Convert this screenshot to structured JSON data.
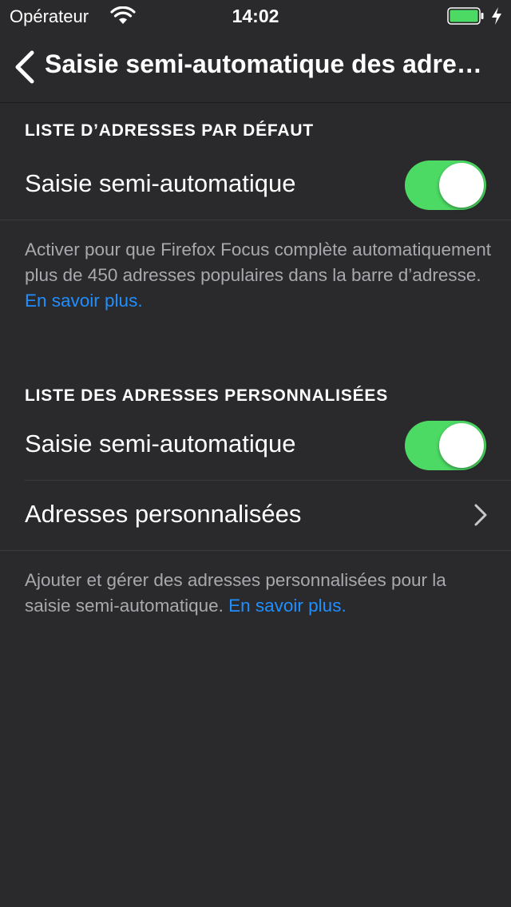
{
  "status_bar": {
    "carrier": "Opérateur",
    "time": "14:02",
    "battery_color": "#4cd964"
  },
  "nav": {
    "back_icon": "chevron-left-icon",
    "title": "Saisie semi-automatique des adresses"
  },
  "default_section": {
    "header": "LISTE D’ADRESSES PAR DÉFAUT",
    "autofill_label": "Saisie semi-automatique",
    "autofill_enabled": true,
    "footer_text": "Activer pour que Firefox Focus complète automatiquement plus de 450 adresses populaires dans la barre d’adresse. ",
    "footer_link": "En savoir plus."
  },
  "custom_section": {
    "header": "LISTE DES ADRESSES PERSONNALISÉES",
    "autofill_label": "Saisie semi-automatique",
    "autofill_enabled": true,
    "custom_urls_label": "Adresses personnalisées",
    "footer_text": "Ajouter et gérer des adresses personnalisées pour la saisie semi-automatique. ",
    "footer_link": "En savoir plus."
  },
  "colors": {
    "background": "#2a2a2c",
    "toggle_on": "#4cd964",
    "link": "#1f8fff",
    "footer_text": "#a9a9ad"
  }
}
